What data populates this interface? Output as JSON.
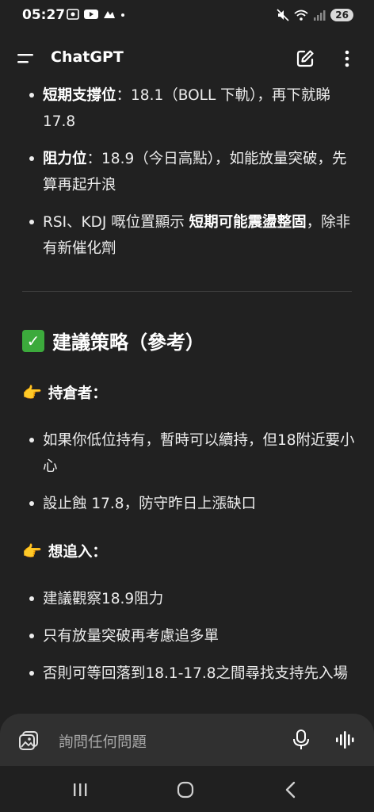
{
  "status": {
    "time": "05:27",
    "battery": "26"
  },
  "appbar": {
    "title": "ChatGPT"
  },
  "bullets_top": [
    {
      "bold": "短期支撐位",
      "sep": "：",
      "text": "18.1（BOLL 下軌），再下就睇 17.8"
    },
    {
      "bold": "阻力位",
      "sep": "：",
      "text": "18.9（今日高點），如能放量突破，先算再起升浪"
    },
    {
      "pre": "RSI、KDJ 嘅位置顯示 ",
      "bold": "短期可能震盪整固",
      "post": "，除非有新催化劑"
    }
  ],
  "section": {
    "heading": "建議策略（參考）"
  },
  "holders": {
    "heading": "持倉者：",
    "items": [
      "如果你低位持有，暫時可以續持，但18附近要小心",
      "設止蝕 17.8，防守昨日上漲缺口"
    ]
  },
  "chasers": {
    "heading": "想追入：",
    "items": [
      "建議觀察18.9阻力",
      "只有放量突破再考慮追多單",
      "否則可等回落到18.1-17.8之間尋找支持先入場"
    ]
  },
  "composer": {
    "placeholder": "詢問任何問題"
  }
}
